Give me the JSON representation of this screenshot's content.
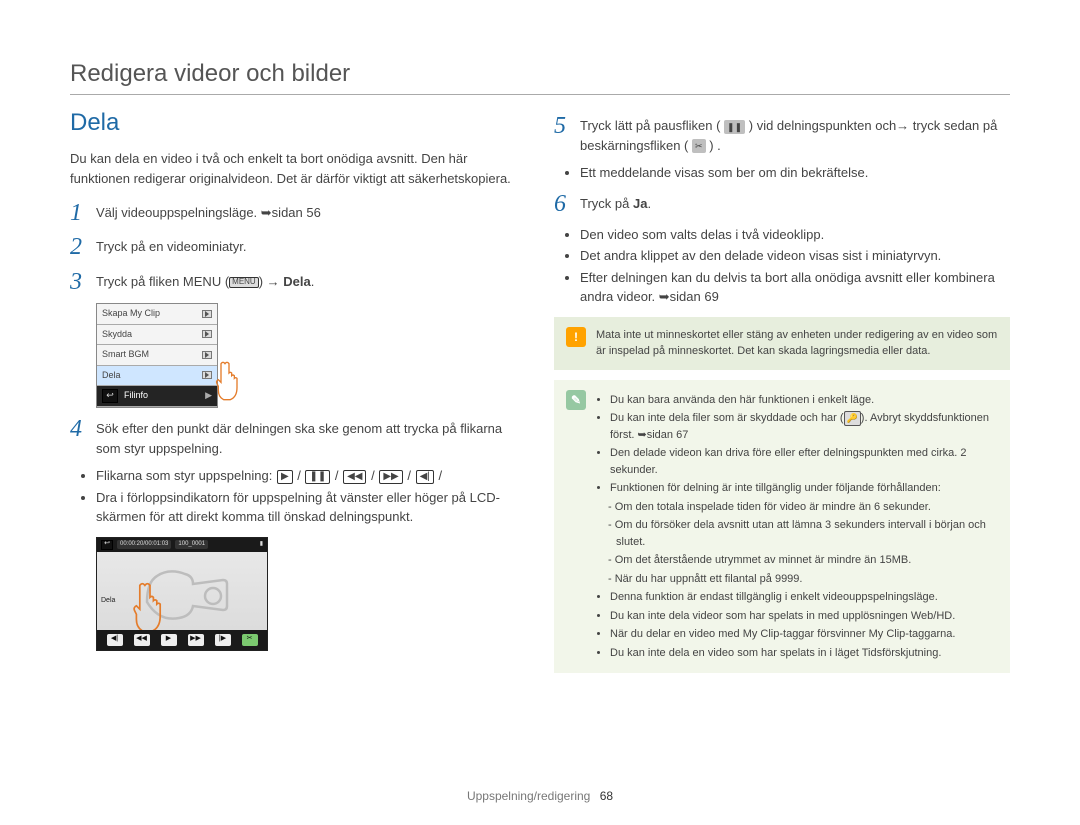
{
  "page_title": "Redigera videor och bilder",
  "section_title": "Dela",
  "intro": "Du kan dela en video i två och enkelt ta bort onödiga avsnitt. Den här funktionen redigerar originalvideon. Det är därför viktigt att säkerhetskopiera.",
  "steps_left": {
    "s1": "Välj videouppspelningsläge. ➥sidan 56",
    "s2": "Tryck på en videominiatyr.",
    "s3_pre": "Tryck på fliken MENU (",
    "s3_menu_badge": "MENU",
    "s3_post": ") → Dela.",
    "s4": "Sök efter den punkt där delningen ska ske genom att trycka på flikarna som styr uppspelning.",
    "s4_b1_label": "Flikarna som styr uppspelning:",
    "s4_controls": [
      "▶",
      "❚❚",
      "◀◀",
      "▶▶",
      "◀|"
    ],
    "s4_b2": "Dra i förloppsindikatorn för uppspelning åt vänster eller höger på LCD-skärmen för att direkt komma till önskad delningspunkt."
  },
  "menu": {
    "items": [
      "Skapa My Clip",
      "Skydda",
      "Smart BGM",
      "Dela",
      "Filinfo"
    ],
    "selected_index": 3
  },
  "player": {
    "timecode": "00:00:20/00:01:03",
    "file": "100_0001",
    "label": "Dela"
  },
  "steps_right": {
    "s5_pre": "Tryck lätt på pausfliken (",
    "s5_icon1": "❚❚",
    "s5_mid": ") vid delningspunkten och→ tryck sedan på beskärningsfliken (",
    "s5_icon2": "✂",
    "s5_post": ") .",
    "s5_b1": "Ett meddelande visas som ber om din bekräftelse.",
    "s6": "Tryck på Ja.",
    "s6_b1": "Den video som valts delas i två videoklipp.",
    "s6_b2": "Det andra klippet av den delade videon visas sist i miniatyrvyn.",
    "s6_b3": "Efter delningen kan du delvis ta bort alla onödiga avsnitt eller kombinera andra videor. ➥sidan 69"
  },
  "warning": "Mata inte ut minneskortet eller stäng av enheten under redigering av en video som är inspelad på minneskortet. Det kan skada lagringsmedia eller data.",
  "notes": [
    {
      "t": "Du kan bara använda den här funktionen i enkelt läge."
    },
    {
      "pre": "Du kan inte dela filer som är skyddade och har (",
      "icon": "🔑",
      "post": "). Avbryt skyddsfunktionen först. ➥sidan 67"
    },
    {
      "t": "Den delade videon kan driva före eller efter delningspunkten med cirka. 2 sekunder."
    },
    {
      "t": "Funktionen för delning är inte tillgänglig under följande förhållanden:"
    },
    {
      "sub": true,
      "t": "Om den totala inspelade tiden för video är mindre än 6 sekunder."
    },
    {
      "sub": true,
      "t": "Om du försöker dela avsnitt utan att lämna 3 sekunders intervall i början och slutet."
    },
    {
      "sub": true,
      "t": "Om det återstående utrymmet av minnet är mindre än 15MB."
    },
    {
      "sub": true,
      "t": "När du har uppnått ett filantal på 9999."
    },
    {
      "t": "Denna funktion är endast tillgänglig i enkelt videouppspelningsläge."
    },
    {
      "t": "Du kan inte dela videor som har spelats in med upplösningen Web/HD."
    },
    {
      "t": "När du delar en video med My Clip-taggar försvinner My Clip-taggarna."
    },
    {
      "t": "Du kan inte dela en video som har spelats in i läget Tidsförskjutning."
    }
  ],
  "footer": {
    "section": "Uppspelning/redigering",
    "page": "68"
  }
}
